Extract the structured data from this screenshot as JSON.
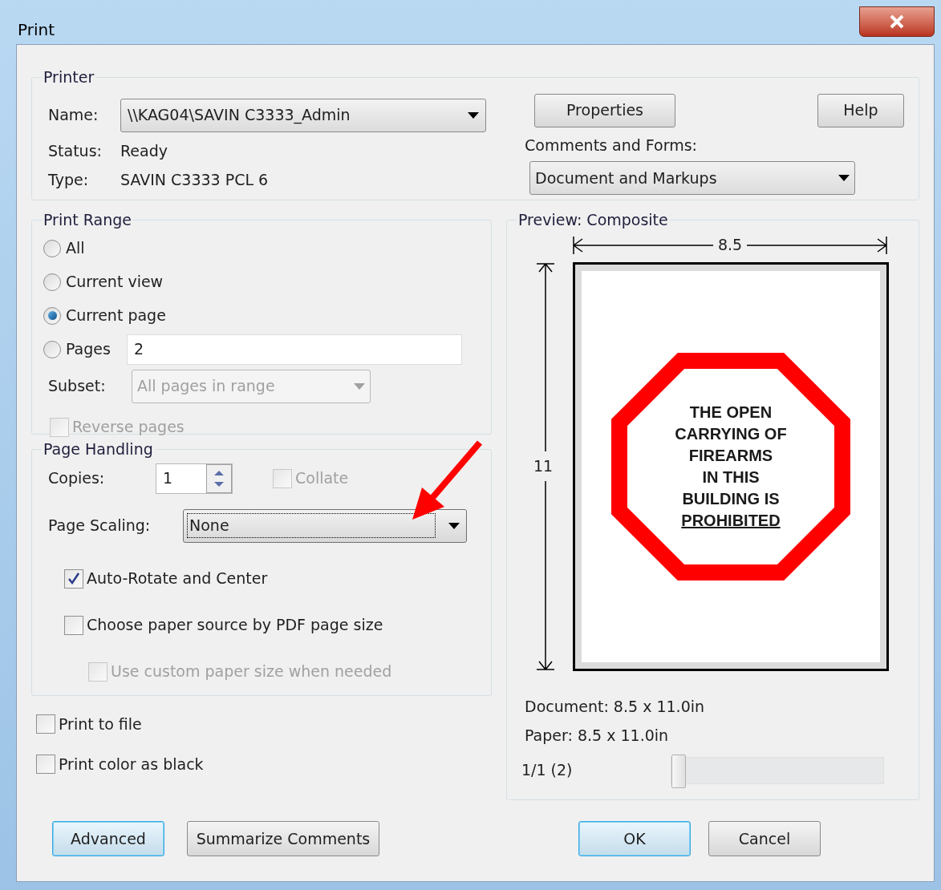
{
  "window": {
    "title": "Print"
  },
  "printer": {
    "title": "Printer",
    "name_label": "Name:",
    "name_value": "\\\\KAG04\\SAVIN C3333_Admin",
    "status_label": "Status:",
    "status": "Ready",
    "type_label": "Type:",
    "type": "SAVIN C3333 PCL 6",
    "properties_button": "Properties",
    "help_button": "Help",
    "comments_label": "Comments and Forms:",
    "comments_value": "Document and Markups"
  },
  "print_range": {
    "title": "Print Range",
    "options": [
      {
        "label": "All",
        "selected": false
      },
      {
        "label": "Current view",
        "selected": false
      },
      {
        "label": "Current page",
        "selected": true
      },
      {
        "label": "Pages",
        "selected": false,
        "value": "2"
      }
    ],
    "subset_label": "Subset:",
    "subset_value": "All pages in range",
    "subset_disabled": true,
    "reverse": {
      "label": "Reverse pages",
      "checked": false,
      "disabled": true
    }
  },
  "page_handling": {
    "title": "Page Handling",
    "copies_label": "Copies:",
    "copies": "1",
    "collate": {
      "label": "Collate",
      "checked": false,
      "disabled": true
    },
    "scaling_label": "Page Scaling:",
    "scaling_value": "None",
    "scaling_focused": true,
    "options": [
      {
        "label": "Auto-Rotate and Center",
        "checked": true,
        "disabled": false
      },
      {
        "label": "Choose paper source by PDF page size",
        "checked": false,
        "disabled": false,
        "children": [
          {
            "label": "Use custom paper size when needed",
            "checked": false,
            "disabled": true
          }
        ]
      }
    ]
  },
  "output_options": [
    {
      "label": "Print to file",
      "checked": false
    },
    {
      "label": "Print color as black",
      "checked": false
    }
  ],
  "preview": {
    "title": "Preview: Composite",
    "width_label": "8.5",
    "height_label": "11",
    "page_lines": [
      {
        "text": "THE OPEN",
        "underlined": false
      },
      {
        "text": "CARRYING OF",
        "underlined": false
      },
      {
        "text": "FIREARMS",
        "underlined": false
      },
      {
        "text": "IN THIS",
        "underlined": false
      },
      {
        "text": "BUILDING IS",
        "underlined": false
      },
      {
        "text": "PROHIBITED",
        "underlined": true
      }
    ],
    "document_size": "Document: 8.5 x 11.0in",
    "paper_size": "Paper: 8.5 x 11.0in",
    "page_counter": "1/1 (2)",
    "slider": {
      "level": 0
    }
  },
  "left_buttons": [
    {
      "label": "Advanced",
      "focused": true
    },
    {
      "label": "Summarize Comments",
      "focused": false
    }
  ],
  "right_buttons": [
    {
      "label": "OK",
      "focused": true
    },
    {
      "label": "Cancel",
      "focused": false
    }
  ]
}
